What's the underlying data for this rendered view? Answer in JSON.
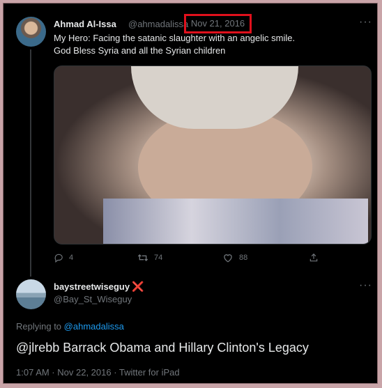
{
  "original_tweet": {
    "display_name": "Ahmad Al-Issa",
    "handle": "@ahmadalissa",
    "date": "Nov 21, 2016",
    "text_line1": "My Hero: Facing the satanic slaughter with an angelic smile.",
    "text_line2": "God Bless Syria and all the Syrian children",
    "counts": {
      "reply": "4",
      "retweet": "74",
      "like": "88"
    }
  },
  "reply_tweet": {
    "display_name": "baystreetwiseguy",
    "badge": "❌",
    "handle": "@Bay_St_Wiseguy",
    "replying_to_prefix": "Replying to",
    "replying_to_handle": "@ahmadalissa",
    "text": "@jlrebb Barrack Obama and Hillary Clinton's Legacy",
    "meta": "1:07 AM · Nov 22, 2016 · Twitter for iPad"
  },
  "more_label": "···",
  "colors": {
    "highlight_box": "#e0101c",
    "link": "#1d9bf0",
    "muted": "#71767b",
    "text": "#e7e9ea"
  },
  "icons": [
    "reply-icon",
    "retweet-icon",
    "like-icon",
    "share-icon",
    "more-icon"
  ]
}
